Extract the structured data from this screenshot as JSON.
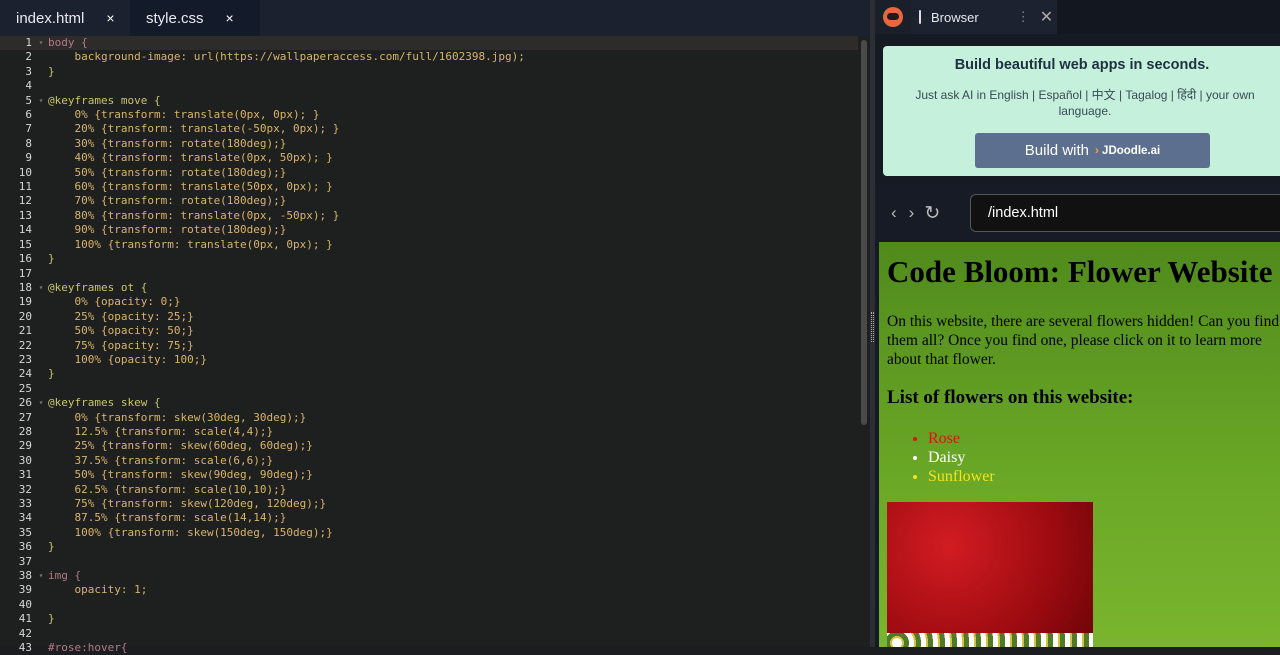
{
  "editor": {
    "tabs": [
      {
        "label": "index.html",
        "active": false
      },
      {
        "label": "style.css",
        "active": true
      }
    ],
    "close_glyph": "×",
    "lines": [
      "body {",
      "    background-image: url(https://wallpaperaccess.com/full/1602398.jpg);",
      "}",
      "",
      "@keyframes move {",
      "    0% {transform: translate(0px, 0px); }",
      "    20% {transform: translate(-50px, 0px); }",
      "    30% {transform: rotate(180deg);}",
      "    40% {transform: translate(0px, 50px); }",
      "    50% {transform: rotate(180deg);}",
      "    60% {transform: translate(50px, 0px); }",
      "    70% {transform: rotate(180deg);}",
      "    80% {transform: translate(0px, -50px); }",
      "    90% {transform: rotate(180deg);}",
      "    100% {transform: translate(0px, 0px); }",
      "}",
      "",
      "@keyframes ot {",
      "    0% {opacity: 0;}",
      "    25% {opacity: 25;}",
      "    50% {opacity: 50;}",
      "    75% {opacity: 75;}",
      "    100% {opacity: 100;}",
      "}",
      "",
      "@keyframes skew {",
      "    0% {transform: skew(30deg, 30deg);}",
      "    12.5% {transform: scale(4,4);}",
      "    25% {transform: skew(60deg, 60deg);}",
      "    37.5% {transform: scale(6,6);}",
      "    50% {transform: skew(90deg, 90deg);}",
      "    62.5% {transform: scale(10,10);}",
      "    75% {transform: skew(120deg, 120deg);}",
      "    87.5% {transform: scale(14,14);}",
      "    100% {transform: skew(150deg, 150deg);}",
      "}",
      "",
      "img {",
      "    opacity: 1;",
      "",
      "}",
      "",
      "#rose:hover{"
    ],
    "fold_lines": [
      1,
      5,
      18,
      26,
      38
    ]
  },
  "browser": {
    "tab_label": "Browser",
    "menu_glyph": "⋮",
    "close_glyph": "✕",
    "promo": {
      "title": "Build beautiful web apps in seconds.",
      "text": "Just ask AI in English | Español | 中文 | Tagalog | हिंदी | your own language.",
      "button_prefix": "Build with",
      "button_brand_mark": "›",
      "button_brand": "JDoodle.ai"
    },
    "nav": {
      "back": "‹",
      "forward": "›",
      "reload": "↻",
      "url": "/index.html"
    },
    "page": {
      "title": "Code Bloom: Flower Website",
      "intro": "On this website, there are several flowers hidden! Can you find them all? Once you find one, please click on it to learn more about that flower.",
      "list_heading": "List of flowers on this website:",
      "flowers": [
        {
          "name": "Rose",
          "color": "#e01010"
        },
        {
          "name": "Daisy",
          "color": "#ffffff"
        },
        {
          "name": "Sunflower",
          "color": "#f5e31a"
        }
      ]
    }
  }
}
